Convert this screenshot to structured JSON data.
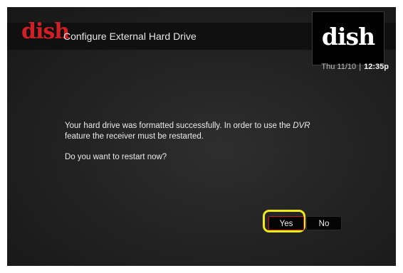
{
  "header": {
    "brand": "dish",
    "title": "Configure External Hard Drive",
    "logo_box_text": "dish"
  },
  "clock": {
    "date": "Thu 11/10",
    "separator": "|",
    "time": "12:35p"
  },
  "dialog": {
    "message_before": "Your hard drive was formatted successfully. In order to use the ",
    "message_em": "DVR",
    "message_after": " feature the receiver must be restarted.",
    "question": "Do you want to restart now?"
  },
  "buttons": {
    "yes": "Yes",
    "no": "No"
  },
  "colors": {
    "brand_red": "#d21f26",
    "focus_highlight": "#f2ea14",
    "background": "#232323"
  }
}
